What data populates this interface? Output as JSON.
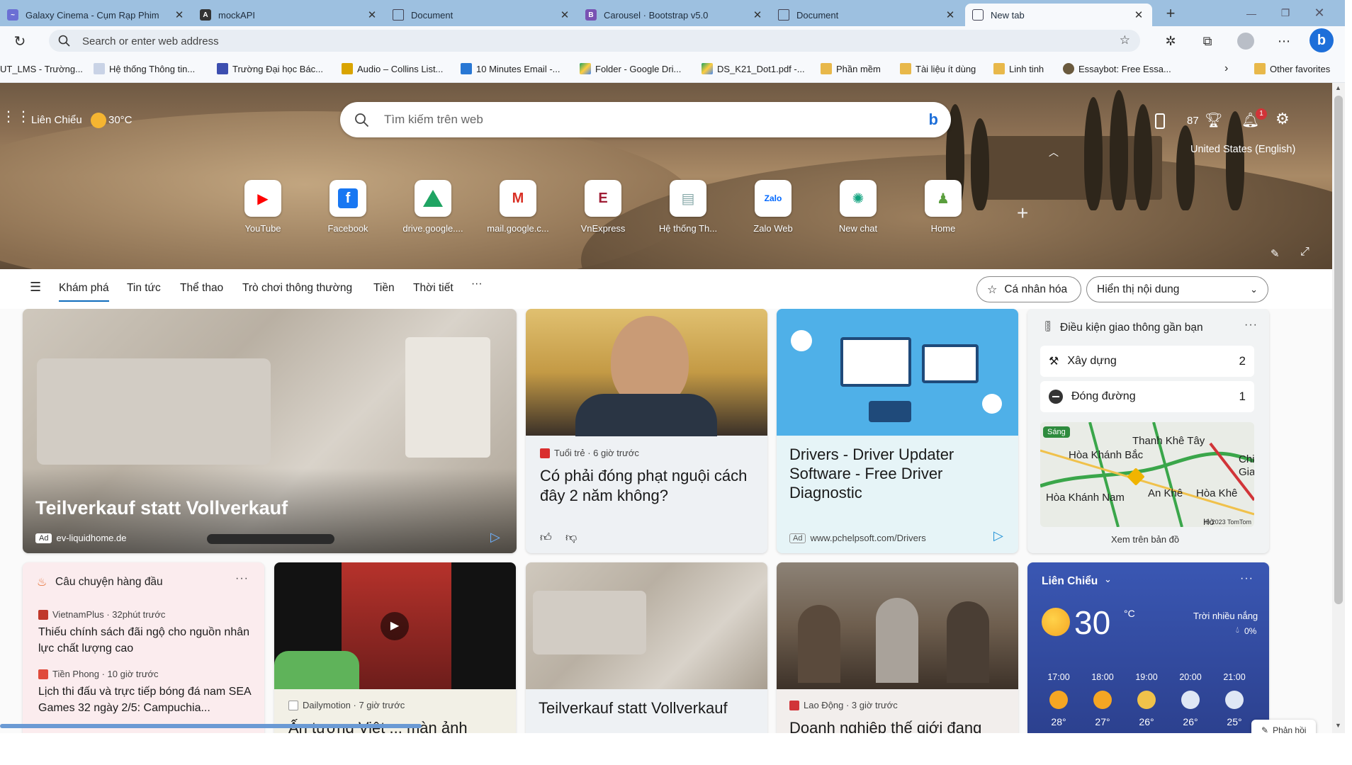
{
  "tabs": [
    {
      "title": "Galaxy Cinema - Cụm Rạp Phim",
      "icon": "galaxy-cinema-favicon"
    },
    {
      "title": "mockAPI",
      "icon": "mockapi-favicon"
    },
    {
      "title": "Document",
      "icon": "document-icon"
    },
    {
      "title": "Carousel · Bootstrap v5.0",
      "icon": "bootstrap-favicon"
    },
    {
      "title": "Document",
      "icon": "document-icon"
    },
    {
      "title": "New tab",
      "icon": "new-tab-icon"
    }
  ],
  "address": {
    "placeholder": "Search or enter web address"
  },
  "favorites": [
    {
      "label": "UT_LMS - Trường..."
    },
    {
      "label": "Hệ thống Thông tin..."
    },
    {
      "label": "Trường Đại học Bác..."
    },
    {
      "label": "Audio – Collins List..."
    },
    {
      "label": "10 Minutes Email -..."
    },
    {
      "label": "Folder - Google Dri..."
    },
    {
      "label": "DS_K21_Dot1.pdf -..."
    },
    {
      "label": "Phần mềm"
    },
    {
      "label": "Tài liệu ít dùng"
    },
    {
      "label": "Linh tinh"
    },
    {
      "label": "Essaybot: Free Essa..."
    }
  ],
  "other_favorites": "Other favorites",
  "hero": {
    "location": "Liên Chiểu",
    "temp": "30°C",
    "search_placeholder": "Tìm kiếm trên web",
    "rewards": "87",
    "notif_count": "1",
    "region": "United States (English)"
  },
  "quick_links": [
    {
      "label": "YouTube",
      "icon": "youtube-icon"
    },
    {
      "label": "Facebook",
      "icon": "facebook-icon"
    },
    {
      "label": "drive.google....",
      "icon": "google-drive-icon"
    },
    {
      "label": "mail.google.c...",
      "icon": "gmail-icon"
    },
    {
      "label": "VnExpress",
      "icon": "vnexpress-icon"
    },
    {
      "label": "Hệ thống Th...",
      "icon": "system-icon"
    },
    {
      "label": "Zalo Web",
      "icon": "zalo-icon"
    },
    {
      "label": "New chat",
      "icon": "chatgpt-icon"
    },
    {
      "label": "Home",
      "icon": "home-chess-icon"
    }
  ],
  "nav": {
    "items": [
      "Khám phá",
      "Tin tức",
      "Thể thao",
      "Trò chơi thông thường",
      "Tiền",
      "Thời tiết"
    ],
    "more": "···",
    "personalize": "Cá nhân hóa",
    "display": "Hiển thị nội dung"
  },
  "cards": {
    "ad1": {
      "title": "Teilverkauf statt Vollverkauf",
      "ad": "Ad",
      "domain": "ev-liquidhome.de"
    },
    "news1": {
      "source": "Tuổi trẻ · 6 giờ trước",
      "title": "Có phải đóng phạt nguội cách đây 2 năm không?"
    },
    "ad2": {
      "title": "Drivers - Driver Updater Software - Free Driver Diagnostic",
      "ad": "Ad",
      "domain": "www.pchelpsoft.com/Drivers"
    },
    "traffic": {
      "title": "Điều kiện giao thông gần bạn",
      "rows": [
        {
          "label": "Xây dựng",
          "count": "2"
        },
        {
          "label": "Đóng đường",
          "count": "1"
        }
      ],
      "map_badge": "Sáng",
      "map_labels": [
        "Thanh Khê Tây",
        "Hòa Khánh Bắc",
        "Hòa Khánh Nam",
        "An Khê",
        "Hòa Khê",
        "Chir",
        "Gia",
        "Hò",
        "© 2023 TomTom"
      ],
      "map_link": "Xem trên bản đồ"
    },
    "top_stories": {
      "title": "Câu chuyện hàng đầu",
      "items": [
        {
          "source": "VietnamPlus · 32phút trước",
          "title": "Thiếu chính sách đãi ngộ cho nguồn nhân lực chất lượng cao"
        },
        {
          "source": "Tiền Phong · 10 giờ trước",
          "title": "Lịch thi đấu và trực tiếp bóng đá nam SEA Games 32 ngày 2/5: Campuchia..."
        }
      ]
    },
    "video": {
      "source": "Dailymotion · 7 giờ trước",
      "title": "Ấn tượng Việt ... màn ảnh"
    },
    "ad3": {
      "title": "Teilverkauf statt Vollverkauf"
    },
    "news2": {
      "source": "Lao Động · 3 giờ trước",
      "title": "Doanh nghiệp thế giới đang"
    },
    "weather": {
      "location": "Liên Chiểu",
      "temp": "30",
      "unit": "°C",
      "desc": "Trời nhiều nắng",
      "precip": "0%",
      "hours": [
        {
          "time": "17:00",
          "temp": "28°"
        },
        {
          "time": "18:00",
          "temp": "27°"
        },
        {
          "time": "19:00",
          "temp": "26°"
        },
        {
          "time": "20:00",
          "temp": "26°"
        },
        {
          "time": "21:00",
          "temp": "25°"
        }
      ]
    },
    "feedback": "Phản hồi"
  },
  "colors": {
    "accent": "#0f6cbd",
    "tabbar": "#9dc0e0",
    "weather_bg": "#3a4fa0"
  }
}
